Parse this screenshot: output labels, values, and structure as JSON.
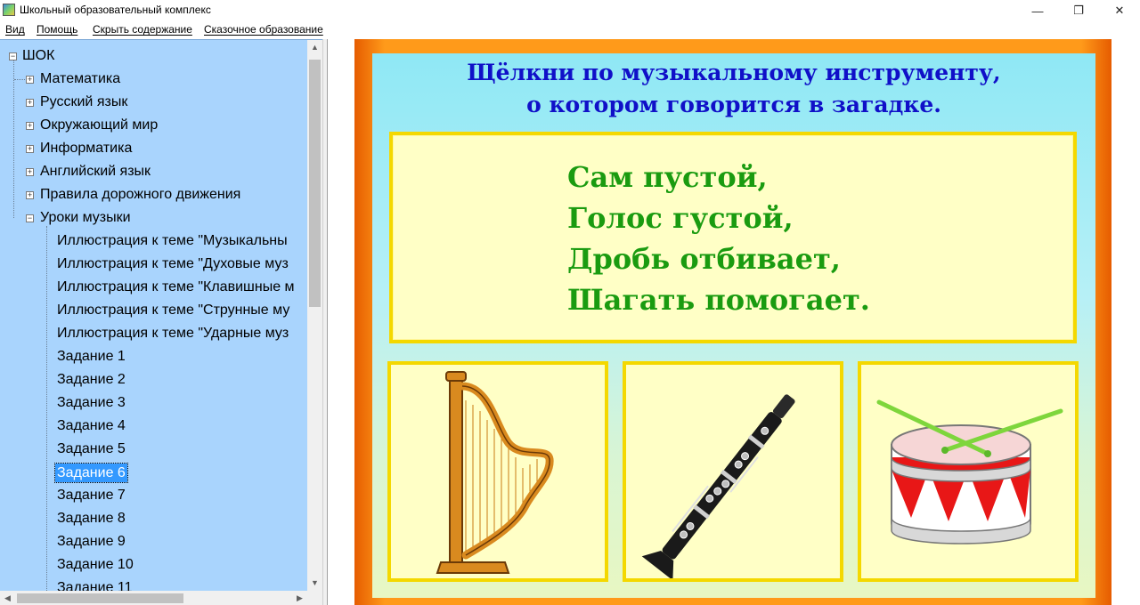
{
  "window": {
    "title": "Школьный образовательный комплекс",
    "minimize_glyph": "—",
    "maximize_glyph": "❐",
    "close_glyph": "✕"
  },
  "menu": [
    "Вид",
    "Помощь",
    "Скрыть содержание",
    "Сказочное образование"
  ],
  "tree": {
    "root": {
      "label": "ШОК",
      "expander": "−"
    },
    "categories": [
      {
        "label": "Математика",
        "expander": "+"
      },
      {
        "label": "Русский язык",
        "expander": "+"
      },
      {
        "label": "Окружающий мир",
        "expander": "+"
      },
      {
        "label": "Информатика",
        "expander": "+"
      },
      {
        "label": "Английский язык",
        "expander": "+"
      },
      {
        "label": "Правила дорожного движения",
        "expander": "+"
      },
      {
        "label": "Уроки музыки",
        "expander": "−"
      }
    ],
    "music_children": [
      "Иллюстрация к теме \"Музыкальны",
      "Иллюстрация к теме \"Духовые муз",
      "Иллюстрация к теме \"Клавишные м",
      "Иллюстрация к теме \"Струнные му",
      "Иллюстрация к теме \"Ударные муз",
      "Задание 1",
      "Задание 2",
      "Задание 3",
      "Задание 4",
      "Задание 5",
      "Задание 6",
      "Задание 7",
      "Задание 8",
      "Задание 9",
      "Задание 10",
      "Задание 11"
    ],
    "selected": "Задание 6"
  },
  "scrollbars": {
    "up": "▲",
    "down": "▼",
    "left": "◀",
    "right": "▶"
  },
  "slide": {
    "heading_line1": "Щёлкни по музыкальному инструменту,",
    "heading_line2": "о котором говорится в загадке.",
    "riddle": [
      "Сам пустой,",
      "Голос густой,",
      "Дробь отбивает,",
      "Шагать помогает."
    ],
    "choices": [
      {
        "id": "harp",
        "icon": "harp-icon"
      },
      {
        "id": "clarinet",
        "icon": "clarinet-icon"
      },
      {
        "id": "drum",
        "icon": "drum-icon"
      }
    ],
    "colors": {
      "heading": "#1010c8",
      "riddle_text": "#1a9b10",
      "frame": "#ff9a1a",
      "card_border": "#f4d800",
      "card_fill": "#ffffc6"
    }
  }
}
